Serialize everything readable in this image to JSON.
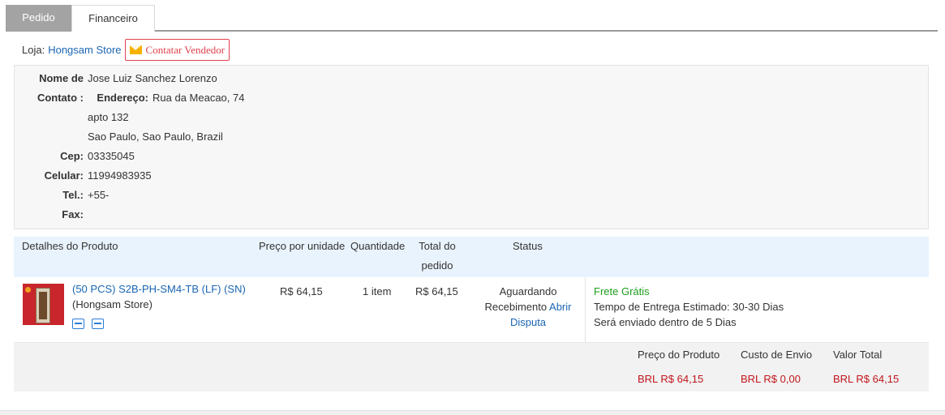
{
  "tabs": [
    {
      "label": "Pedido",
      "active": true
    },
    {
      "label": "Financeiro",
      "active": false
    }
  ],
  "store": {
    "label": "Loja:",
    "name": "Hongsam Store",
    "contact_button": "Contatar Vendedor",
    "contact_icon": "envelope-icon"
  },
  "address": {
    "name_label": "Nome de",
    "name_value": "Jose Luiz Sanchez Lorenzo",
    "contact_label": "Contato :",
    "address_label": "Endereço:",
    "address_line1": "Rua da Meacao, 74",
    "address_line2": "apto 132",
    "address_line3": "Sao Paulo, Sao Paulo, Brazil",
    "cep_label": "Cep:",
    "cep_value": "03335045",
    "cell_label": "Celular:",
    "cell_value": "11994983935",
    "tel_label": "Tel.:",
    "tel_value": "+55-",
    "fax_label": "Fax:",
    "fax_value": ""
  },
  "table": {
    "headers": {
      "product": "Detalhes do Produto",
      "unit_price": "Preço por unidade",
      "quantity": "Quantidade",
      "total_line1": "Total do",
      "total_line2": "pedido",
      "status": "Status"
    },
    "rows": [
      {
        "product_name": "(50 PCS) S2B-PH-SM4-TB (LF) (SN)",
        "product_store": "(Hongsam Store)",
        "unit_price": "R$ 64,15",
        "quantity": "1 item",
        "total": "R$ 64,15",
        "status_line1": "Aguardando",
        "status_line2": "Recebimento",
        "status_link1": "Abrir",
        "status_link2": "Disputa",
        "shipping_free": "Frete Grátis",
        "shipping_time": "Tempo de Entrega Estimado: 30-30 Dias",
        "shipping_sent": "Será enviado dentro de  5 Dias"
      }
    ]
  },
  "totals": {
    "product_price_label": "Preço do Produto",
    "shipping_cost_label": "Custo de Envio",
    "total_label": "Valor Total",
    "product_price": "BRL R$ 64,15",
    "shipping_cost": "BRL R$ 0,00",
    "total": "BRL R$ 64,15"
  },
  "colors": {
    "link": "#1a66b3",
    "price_red": "#c0161c",
    "free_green": "#1e9e1e",
    "contact_red": "#e0424f",
    "header_blue": "#e9f3fd"
  }
}
